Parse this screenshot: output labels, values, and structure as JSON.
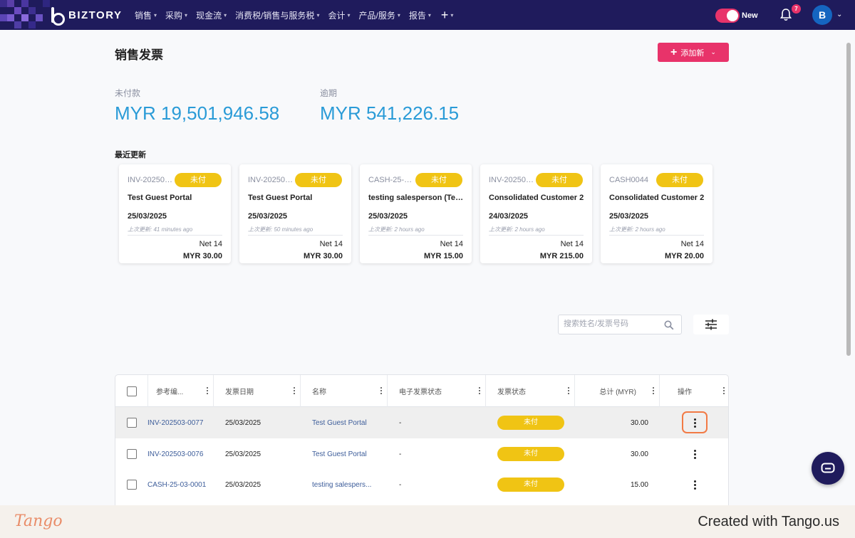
{
  "app": {
    "brand": "BIZTORY",
    "nav": [
      "销售",
      "采购",
      "现金流",
      "消费税/销售与服务税",
      "会计",
      "产品/服务",
      "报告"
    ],
    "toggle_label": "New",
    "notification_count": "7",
    "avatar_initial": "B",
    "accent_color": "#e8336a",
    "nav_bg": "#1f1b5c"
  },
  "page": {
    "title": "销售发票",
    "add_button": "添加新",
    "unpaid_label": "未付款",
    "unpaid_value": "MYR 19,501,946.58",
    "overdue_label": "逾期",
    "overdue_value": "MYR 541,226.15",
    "recent_title": "最近更新"
  },
  "cards": [
    {
      "ref": "INV-202503...",
      "status": "未付",
      "name": "Test Guest Portal",
      "date": "25/03/2025",
      "updated": "上次更新: 41 minutes ago",
      "terms": "Net 14",
      "amount": "MYR 30.00"
    },
    {
      "ref": "INV-202503...",
      "status": "未付",
      "name": "Test Guest Portal",
      "date": "25/03/2025",
      "updated": "上次更新: 50 minutes ago",
      "terms": "Net 14",
      "amount": "MYR 30.00"
    },
    {
      "ref": "CASH-25-03...",
      "status": "未付",
      "name": "testing salesperson (Test...",
      "date": "25/03/2025",
      "updated": "上次更新: 2 hours ago",
      "terms": "Net 14",
      "amount": "MYR 15.00"
    },
    {
      "ref": "INV-202503...",
      "status": "未付",
      "name": "Consolidated Customer 2",
      "date": "24/03/2025",
      "updated": "上次更新: 2 hours ago",
      "terms": "Net 14",
      "amount": "MYR 215.00"
    },
    {
      "ref": "CASH0044",
      "status": "未付",
      "name": "Consolidated Customer 2",
      "date": "25/03/2025",
      "updated": "上次更新: 2 hours ago",
      "terms": "Net 14",
      "amount": "MYR 20.00"
    }
  ],
  "search": {
    "placeholder": "搜索姓名/发票号码"
  },
  "table": {
    "headers": [
      "参考编...",
      "发票日期",
      "名称",
      "电子发票状态",
      "发票状态",
      "总计 (MYR)",
      "操作"
    ],
    "rows": [
      {
        "ref": "INV-202503-0077",
        "date": "25/03/2025",
        "name": "Test Guest Portal",
        "einvoice": "-",
        "status": "未付",
        "total": "30.00"
      },
      {
        "ref": "INV-202503-0076",
        "date": "25/03/2025",
        "name": "Test Guest Portal",
        "einvoice": "-",
        "status": "未付",
        "total": "30.00"
      },
      {
        "ref": "CASH-25-03-0001",
        "date": "25/03/2025",
        "name": "testing salespers...",
        "einvoice": "-",
        "status": "未付",
        "total": "15.00"
      }
    ]
  },
  "footer": {
    "logo": "Tango",
    "created": "Created with Tango.us"
  }
}
